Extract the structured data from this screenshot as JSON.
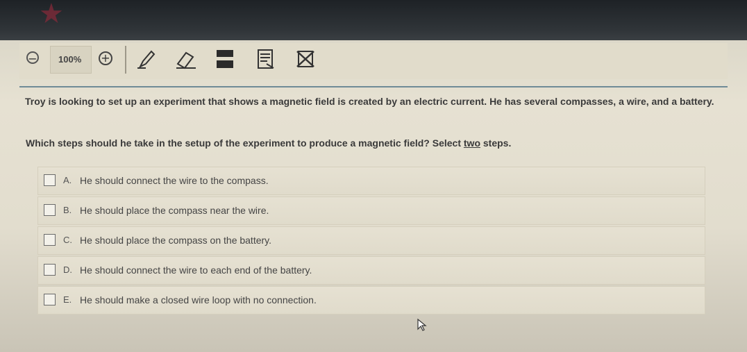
{
  "toolbar": {
    "zoom_level": "100%",
    "zoom_out_icon": "zoom-out-icon",
    "zoom_in_icon": "zoom-in-icon",
    "tools": [
      "pencil-icon",
      "eraser-icon",
      "line-reader-icon",
      "notepad-icon",
      "answer-eliminator-icon"
    ]
  },
  "question": {
    "stem": "Troy is looking to set up an experiment that shows a magnetic field is created by an electric current. He has several compasses, a wire, and a battery.",
    "prompt_before": "Which steps should he take in the setup of the experiment to produce a magnetic field? Select ",
    "prompt_emphasis": "two",
    "prompt_after": " steps."
  },
  "options": [
    {
      "letter": "A.",
      "text": "He should connect the wire to the compass."
    },
    {
      "letter": "B.",
      "text": "He should place the compass near the wire."
    },
    {
      "letter": "C.",
      "text": "He should place the compass on the battery."
    },
    {
      "letter": "D.",
      "text": "He should connect the wire to each end of the battery."
    },
    {
      "letter": "E.",
      "text": "He should make a closed wire loop with no connection."
    }
  ],
  "colors": {
    "screen_bg": "#e2ddce",
    "rule": "#6f8b97",
    "text": "#3a3a3a"
  }
}
